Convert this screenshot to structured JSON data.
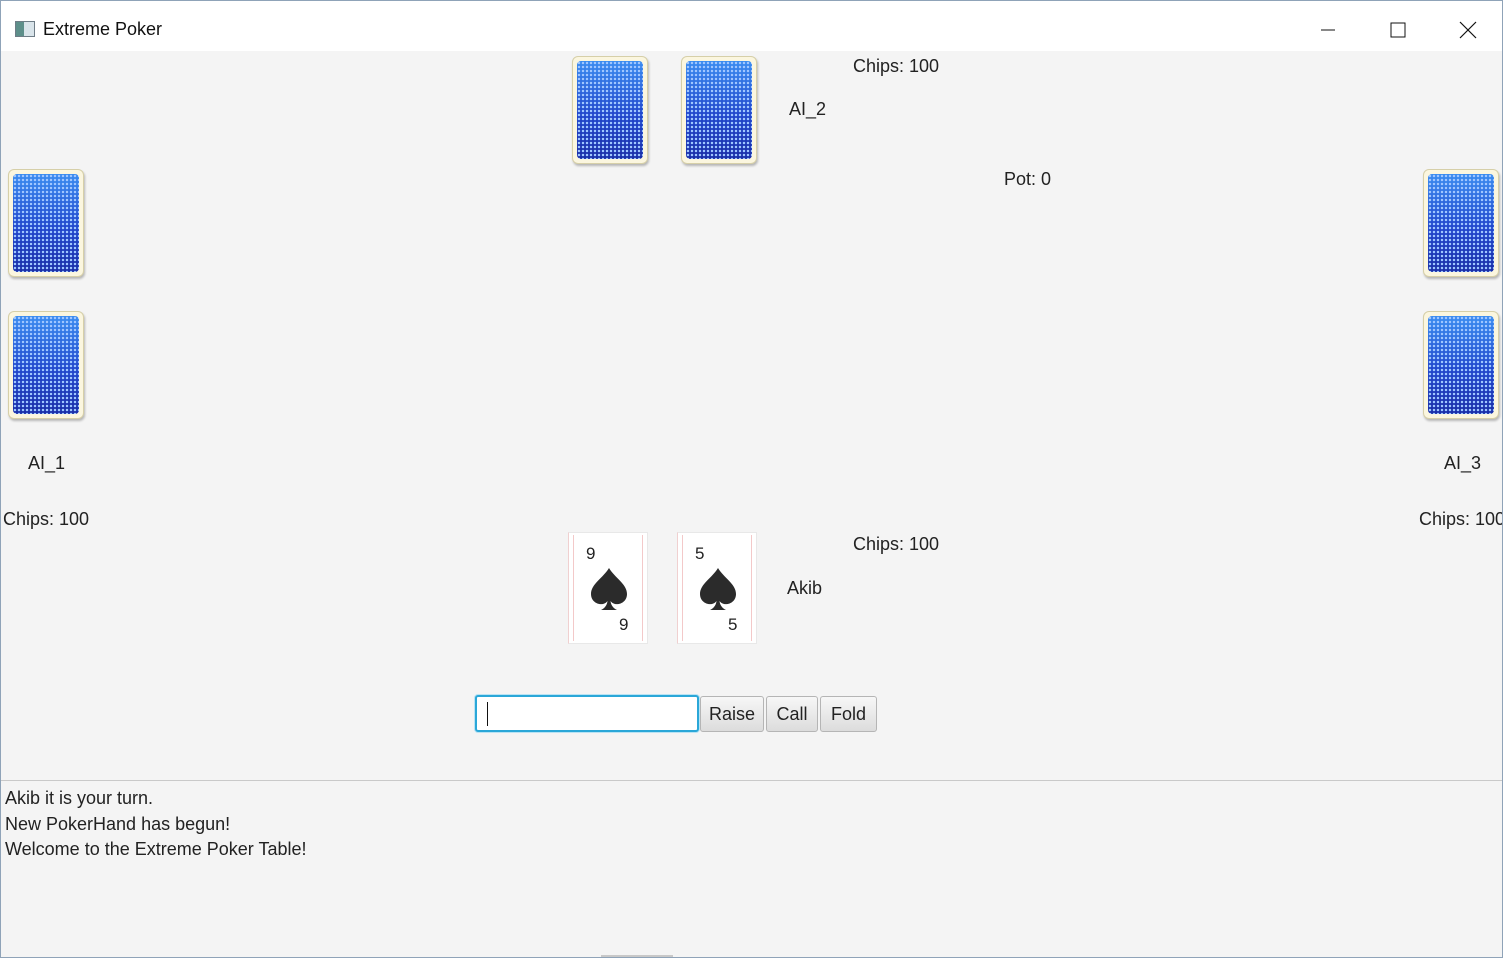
{
  "window": {
    "title": "Extreme Poker",
    "controls": {
      "minimize": "minimize-icon",
      "maximize": "maximize-icon",
      "close": "close-icon"
    }
  },
  "table": {
    "pot": "Pot: 0",
    "card_back_color": "#2a57d8",
    "players": {
      "ai_1": {
        "name": "AI_1",
        "chips": "Chips: 100"
      },
      "ai_2": {
        "name": "AI_2",
        "chips": "Chips: 100"
      },
      "ai_3": {
        "name": "AI_3",
        "chips": "Chips: 100"
      },
      "human": {
        "name": "Akib",
        "chips": "Chips: 100",
        "cards": [
          {
            "rank": "9",
            "suit": "spade"
          },
          {
            "rank": "5",
            "suit": "spade"
          }
        ]
      }
    }
  },
  "controls": {
    "bet_input": {
      "value": "",
      "placeholder": ""
    },
    "raise_label": "Raise",
    "call_label": "Call",
    "fold_label": "Fold",
    "focus_color": "#2aa7d8"
  },
  "log": {
    "lines": [
      "Akib it is your turn.",
      "New PokerHand has begun!",
      "Welcome to the Extreme Poker Table!"
    ]
  }
}
